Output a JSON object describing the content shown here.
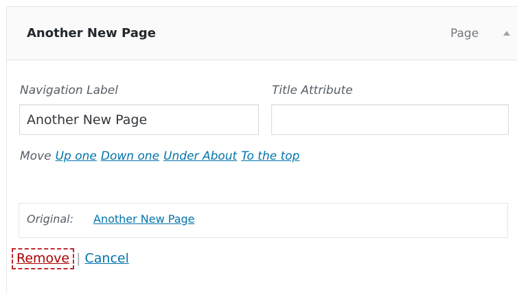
{
  "item": {
    "title": "Another New Page",
    "type": "Page"
  },
  "fields": {
    "navigation_label": "Navigation Label",
    "navigation_value": "Another New Page",
    "title_attribute": "Title Attribute",
    "title_value": ""
  },
  "move": {
    "label": "Move",
    "up_one": "Up one",
    "down_one": "Down one",
    "under_about": "Under About",
    "to_top": "To the top"
  },
  "original": {
    "label": "Original:",
    "link": "Another New Page"
  },
  "actions": {
    "remove": "Remove",
    "separator": "|",
    "cancel": "Cancel"
  },
  "colors": {
    "link": "#0073aa",
    "remove": "#aa0000",
    "focus_outline": "#c0282d"
  },
  "icons": {
    "toggle": "arrow-up-icon"
  }
}
